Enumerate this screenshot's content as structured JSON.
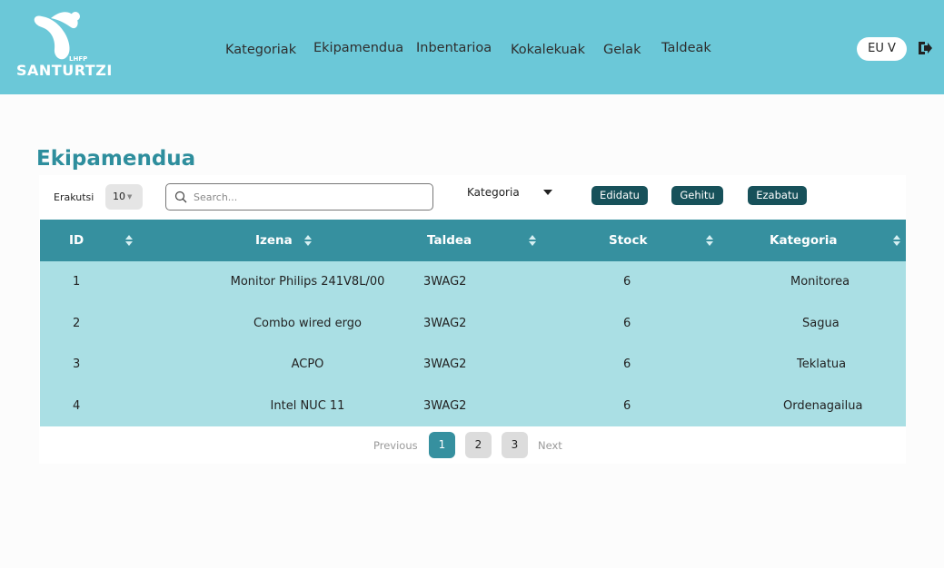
{
  "header": {
    "logo_text": "SANTURTZI",
    "logo_sub": "LHFP",
    "nav": [
      "Kategoriak",
      "Ekipamendua",
      "Inbentarioa",
      "Kokalekuak",
      "Gelak",
      "Taldeak"
    ],
    "language": "EU V"
  },
  "page": {
    "title": "Ekipamendua"
  },
  "controls": {
    "show_label": "Erakutsi",
    "show_value": "10",
    "search_placeholder": "Search...",
    "category_filter": "Kategoria",
    "edit_label": "Edidatu",
    "add_label": "Gehitu",
    "delete_label": "Ezabatu"
  },
  "table": {
    "columns": [
      "ID",
      "Izena",
      "Taldea",
      "Stock",
      "Kategoria"
    ],
    "rows": [
      {
        "id": "1",
        "izena": "Monitor Philips 241V8L/00",
        "taldea": "3WAG2",
        "stock": "6",
        "kategoria": "Monitorea"
      },
      {
        "id": "2",
        "izena": "Combo wired ergo",
        "taldea": "3WAG2",
        "stock": "6",
        "kategoria": "Sagua"
      },
      {
        "id": "3",
        "izena": "ACPO",
        "taldea": "3WAG2",
        "stock": "6",
        "kategoria": "Teklatua"
      },
      {
        "id": "4",
        "izena": "Intel NUC 11",
        "taldea": "3WAG2",
        "stock": "6",
        "kategoria": "Ordenagailua"
      }
    ]
  },
  "pagination": {
    "previous": "Previous",
    "pages": [
      "1",
      "2",
      "3"
    ],
    "current": "1",
    "next": "Next"
  },
  "colors": {
    "header_bg": "#6bc8d8",
    "title": "#2e8e9d",
    "table_header": "#36909f",
    "table_row": "#aadfe4",
    "button": "#17515a"
  },
  "icons": {
    "logo": "santurtzi-logo-icon",
    "logout": "logout-icon",
    "search": "search-icon",
    "sort": "sort-icon",
    "dropdown": "caret-down-icon"
  }
}
